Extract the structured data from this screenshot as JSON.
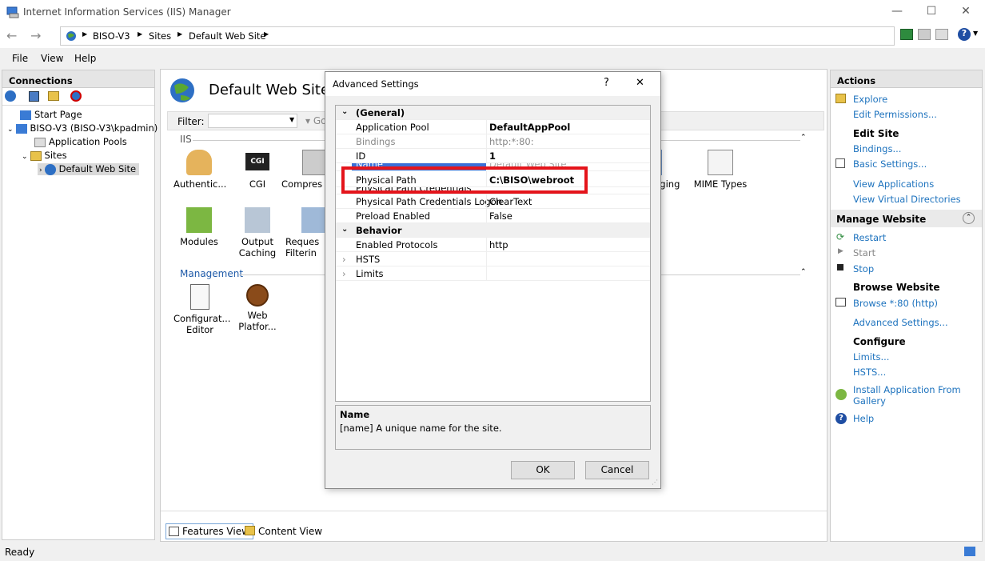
{
  "window": {
    "title": "Internet Information Services (IIS) Manager"
  },
  "address": {
    "crumbs": [
      "BISO-V3",
      "Sites",
      "Default Web Site"
    ]
  },
  "menu": [
    "File",
    "View",
    "Help"
  ],
  "connections": {
    "title": "Connections",
    "tree": [
      "Start Page",
      "BISO-V3 (BISO-V3\\kpadmin)",
      "Application Pools",
      "Sites",
      "Default Web Site"
    ]
  },
  "center": {
    "title": "Default Web Site H",
    "filter_label": "Filter:",
    "go_label": "Go",
    "iis_group": "IIS",
    "management_group": "Management",
    "features_row1": [
      "Authentic...",
      "CGI",
      "Compres",
      "gging",
      "MIME Types"
    ],
    "features_row2": [
      [
        "Modules",
        ""
      ],
      [
        "Output",
        "Caching"
      ],
      [
        "Reques",
        "Filterin"
      ]
    ],
    "features_mgmt": [
      [
        "Configurat...",
        "Editor"
      ],
      [
        "Web",
        "Platfor..."
      ]
    ],
    "cgi_badge": "CGI",
    "view_tabs": [
      "Features View",
      "Content View"
    ]
  },
  "actions": {
    "title": "Actions",
    "explore": "Explore",
    "edit_permissions": "Edit Permissions...",
    "edit_site": "Edit Site",
    "bindings": "Bindings...",
    "basic_settings": "Basic Settings...",
    "view_applications": "View Applications",
    "view_virtual_dirs": "View Virtual Directories",
    "manage_website": "Manage Website",
    "restart": "Restart",
    "start": "Start",
    "stop": "Stop",
    "browse_website": "Browse Website",
    "browse_80": "Browse *:80 (http)",
    "advanced_settings": "Advanced Settings...",
    "configure": "Configure",
    "limits": "Limits...",
    "hsts": "HSTS...",
    "install_app_1": "Install Application From",
    "install_app_2": "Gallery",
    "help": "Help"
  },
  "status": {
    "text": "Ready"
  },
  "dialog": {
    "title": "Advanced Settings",
    "help_glyph": "?",
    "close_glyph": "✕",
    "rows": [
      {
        "key": "(General)",
        "value": "",
        "type": "category"
      },
      {
        "key": "Application Pool",
        "value": "DefaultAppPool",
        "bold": true
      },
      {
        "key": "Bindings",
        "value": "http:*:80:",
        "grey": true
      },
      {
        "key": "ID",
        "value": "1",
        "bold": true
      },
      {
        "key": "Name",
        "value": "Default Web Site",
        "selected": true
      },
      {
        "key": "Physical Path",
        "value": "C:\\BISO\\webroot",
        "bold": true
      },
      {
        "key": "Physical Path Credentials",
        "value": ""
      },
      {
        "key": "Physical Path Credentials Logon",
        "value": "ClearText"
      },
      {
        "key": "Preload Enabled",
        "value": "False"
      },
      {
        "key": "Behavior",
        "value": "",
        "type": "category"
      },
      {
        "key": "Enabled Protocols",
        "value": "http"
      },
      {
        "key": "HSTS",
        "value": "",
        "expand": true
      },
      {
        "key": "Limits",
        "value": "",
        "expand": true
      }
    ],
    "desc_title": "Name",
    "desc_text": "[name] A unique name for the site.",
    "ok": "OK",
    "cancel": "Cancel"
  },
  "colors": {
    "highlight": "#e4141b",
    "link": "#1e73be",
    "selection": "#3a6fd8"
  }
}
